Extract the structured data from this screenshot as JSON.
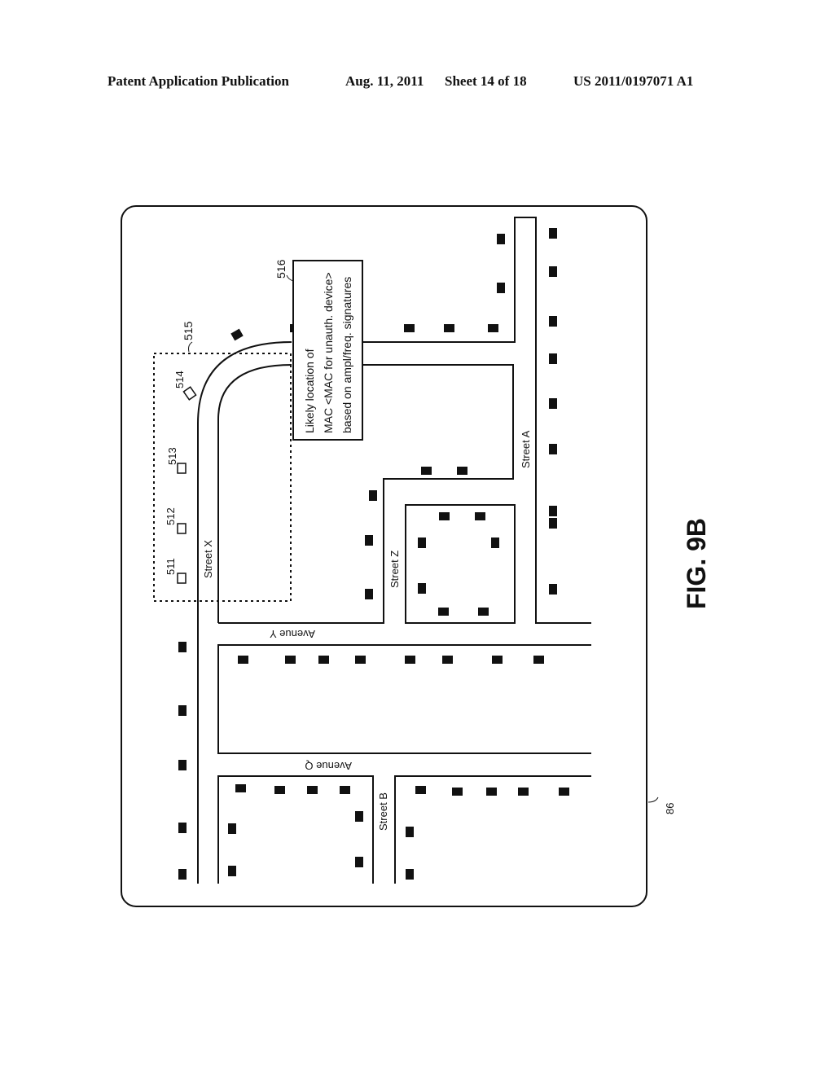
{
  "header": {
    "publication": "Patent Application Publication",
    "date": "Aug. 11, 2011",
    "sheet": "Sheet 14 of 18",
    "number": "US 2011/0197071 A1"
  },
  "figure": {
    "label": "FIG. 9B",
    "frame_ref": "86",
    "zone_ref": "515",
    "callout_ref": "516",
    "callout_lines": [
      "Likely location of",
      "MAC <MAC for unauth. device>",
      "based on ampl/freq. signatures"
    ],
    "sensors": [
      {
        "ref": "511"
      },
      {
        "ref": "512"
      },
      {
        "ref": "513"
      },
      {
        "ref": "514"
      }
    ],
    "streets": {
      "street_x": "Street X",
      "street_z": "Street Z",
      "street_a": "Street A",
      "street_b": "Street B",
      "avenue_y": "Avenue Y",
      "avenue_q": "Avenue Q"
    }
  }
}
